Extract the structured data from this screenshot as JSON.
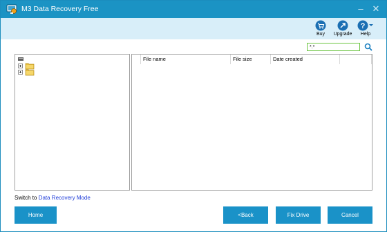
{
  "window": {
    "title": "M3 Data Recovery Free",
    "minimize_glyph": "–",
    "close_glyph": "✕"
  },
  "toolbar": {
    "buy_label": "Buy",
    "upgrade_label": "Upgrade",
    "help_label": "Help"
  },
  "search": {
    "value": "*.*"
  },
  "file_list": {
    "columns": [
      "File name",
      "File size",
      "Date created"
    ]
  },
  "footer": {
    "switch_prefix": "Switch to ",
    "switch_link": "Data Recovery Mode",
    "home_label": "Home",
    "back_label": "<Back",
    "fix_label": "Fix Drive",
    "cancel_label": "Cancel"
  },
  "colors": {
    "titlebar": "#1b93c4",
    "toolbar_band": "#d8eef9",
    "button": "#1a92c8",
    "link": "#1c3ad8",
    "search_border": "#6ac43f"
  },
  "icons": [
    "app-icon",
    "buy-icon",
    "upgrade-icon",
    "help-icon",
    "search-icon",
    "drive-icon",
    "folder-icon"
  ]
}
